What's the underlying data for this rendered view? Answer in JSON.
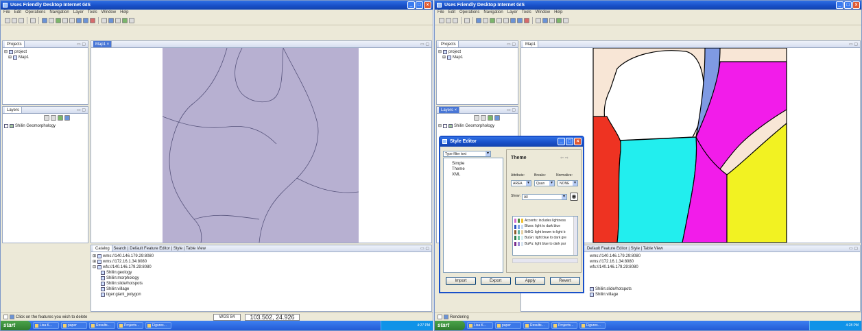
{
  "app_title": "Uses Friendly Desktop Internet GIS",
  "colors": {
    "titlebar": "#1950c9",
    "map_polygon_left": "#b7b0d1",
    "taskbar": "#245edb",
    "zone_peach": "#f8e6d6",
    "zone_white": "#ffffff",
    "zone_blue": "#7f9ae3",
    "zone_magenta": "#f21cea",
    "zone_red": "#ee3322",
    "zone_cyan": "#22eeee",
    "zone_yellow": "#f2f222"
  },
  "menu": [
    "File",
    "Edit",
    "Operations",
    "Navigation",
    "Layer",
    "Tools",
    "Window",
    "Help"
  ],
  "left": {
    "projects_tab": "Projects",
    "project_root": "project",
    "project_map": "Map1",
    "map_tab": "Map1",
    "layers_tab": "Layers",
    "layer_name": "Shilin Geomorphology",
    "catalog_tabs": [
      "Catalog",
      "Search",
      "Default Feature Editor",
      "Style",
      "Table View"
    ],
    "catalog_items": [
      "wms://140.146.179.29:8080",
      "wms://172.16.1.34:8080",
      "wfs://140.146.179.29:8080",
      "Shilin:geology",
      "Shilin:morphology",
      "Shilin:slide/hotspots",
      "Shilin:village",
      "tiger:giant_polygon"
    ],
    "status_text": "Click on the features you wish to delete",
    "scale": "WGS 84",
    "coords": "103.502, 24.926"
  },
  "right": {
    "projects_tab": "Projects",
    "project_root": "project",
    "project_map": "Map1",
    "map_tab": "Map1",
    "layers_tab": "Layers",
    "layer_name": "Shilin Geomorphology",
    "catalog_tabs": [
      "Default Feature Editor",
      "Style",
      "Table View"
    ],
    "catalog_items": [
      "wms://140.146.179.29:8080",
      "wms://172.16.1.34:8080",
      "wfs://140.146.179.29:8080",
      "Shilin:slide/hotspots",
      "Shilin:village"
    ],
    "status_text": "Rendering"
  },
  "style_editor": {
    "title": "Style Editor",
    "type_filter": "Type filter text",
    "styles": [
      "Simple",
      "Theme",
      "XML"
    ],
    "theme_heading": "Theme",
    "attribute_label": "Attribute:",
    "breaks_label": "Breaks:",
    "normalize_label": "Normalize:",
    "attribute_value": "AREA",
    "breaks_value": "Quan",
    "normalize_value": "NONE",
    "show_label": "Show:",
    "show_value": "All",
    "palettes": [
      {
        "name": "Accents: includes lightness",
        "colors": [
          "#d66bcc",
          "#4a8a3a",
          "#f0c030"
        ]
      },
      {
        "name": "Blues: light to dark blue",
        "colors": [
          "#2b4fbf",
          "#7ea4e6",
          "#c9dcf5"
        ]
      },
      {
        "name": "BrBG: light brown to light b",
        "colors": [
          "#8c5a2a",
          "#5ab0a0",
          "#e6d2a8"
        ]
      },
      {
        "name": "BuGn: light blue to dark gre",
        "colors": [
          "#2a7a4a",
          "#6ec4a0",
          "#d8eef0"
        ]
      },
      {
        "name": "BuPu: light blue to dark pur",
        "colors": [
          "#7a2a8a",
          "#9c8ad6",
          "#d8e4f0"
        ]
      }
    ],
    "buttons": [
      "Import",
      "Export",
      "Apply",
      "Revert"
    ]
  },
  "taskbar": {
    "start": "start",
    "left_tasks": [
      "Lisa K...",
      "paper",
      "Results...",
      "Projects...",
      "Figures..."
    ],
    "right_tasks": [
      "Lisa K...",
      "paper",
      "Results...",
      "Projects...",
      "Figures..."
    ],
    "left_clock": "4:27 PM",
    "right_clock": "4:28 PM"
  }
}
